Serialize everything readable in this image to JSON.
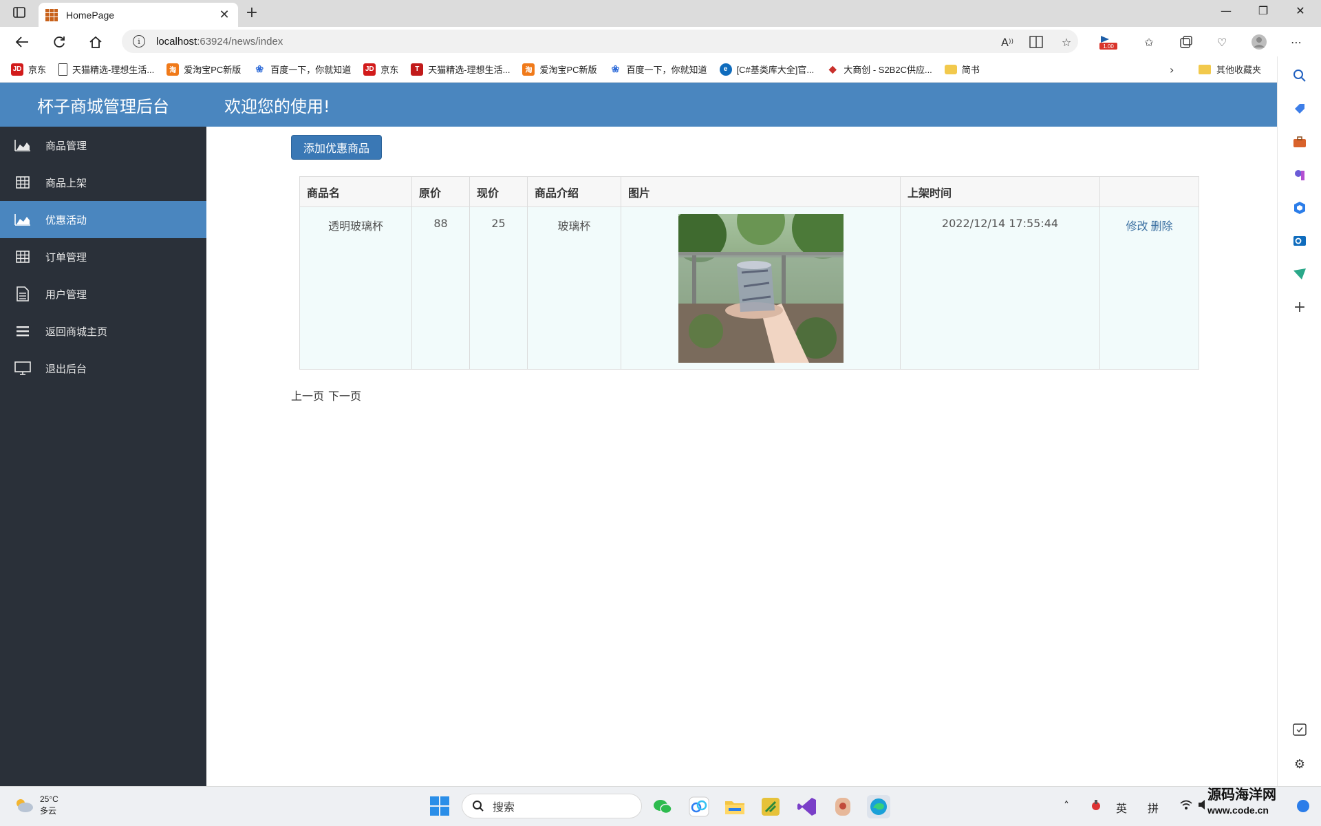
{
  "browser": {
    "tab_title": "HomePage",
    "url_host": "localhost",
    "url_path": ":63924/news/index",
    "bookmarks": [
      {
        "label": "京东",
        "icon": "jd-icon",
        "color": "#d21b1b",
        "glyph": "JD"
      },
      {
        "label": "天猫精选-理想生活...",
        "icon": "page-icon",
        "color": "#ffffff",
        "glyph": ""
      },
      {
        "label": "爱淘宝PC新版",
        "icon": "taobao-icon",
        "color": "#f07a1a",
        "glyph": "淘"
      },
      {
        "label": "百度一下，你就知道",
        "icon": "baidu-icon",
        "color": "#2f6cd9",
        "glyph": "❀"
      },
      {
        "label": "京东",
        "icon": "jd-icon",
        "color": "#d21b1b",
        "glyph": "JD"
      },
      {
        "label": "天猫精选-理想生活...",
        "icon": "tmall-icon",
        "color": "#c11a1a",
        "glyph": "T"
      },
      {
        "label": "爱淘宝PC新版",
        "icon": "taobao-icon",
        "color": "#f07a1a",
        "glyph": "淘"
      },
      {
        "label": "百度一下，你就知道",
        "icon": "baidu-icon",
        "color": "#2f6cd9",
        "glyph": "❀"
      },
      {
        "label": "[C#基类库大全]官...",
        "icon": "edge-icon",
        "color": "#0f6cbd",
        "glyph": "e"
      },
      {
        "label": "大商创 - S2B2C供应...",
        "icon": "dsc-icon",
        "color": "#c9302c",
        "glyph": "◆"
      },
      {
        "label": "简书",
        "icon": "folder-icon",
        "color": "#f2c94c",
        "glyph": ""
      }
    ],
    "other_bookmarks": "其他收藏夹",
    "zoom_badge": "1.00"
  },
  "app": {
    "brand": "杯子商城管理后台",
    "welcome": "欢迎您的使用!"
  },
  "sidebar": {
    "items": [
      {
        "label": "商品管理",
        "name": "sidebar-item-goods-manage",
        "icon": "area-chart-icon",
        "active": false
      },
      {
        "label": "商品上架",
        "name": "sidebar-item-goods-shelf",
        "icon": "table-icon",
        "active": false
      },
      {
        "label": "优惠活动",
        "name": "sidebar-item-promotions",
        "icon": "area-chart-icon",
        "active": true
      },
      {
        "label": "订单管理",
        "name": "sidebar-item-orders",
        "icon": "table-icon",
        "active": false
      },
      {
        "label": "用户管理",
        "name": "sidebar-item-users",
        "icon": "document-icon",
        "active": false
      },
      {
        "label": "返回商城主页",
        "name": "sidebar-item-back-home",
        "icon": "menu-icon",
        "active": false
      },
      {
        "label": "退出后台",
        "name": "sidebar-item-logout",
        "icon": "monitor-icon",
        "active": false
      }
    ]
  },
  "main": {
    "add_button": "添加优惠商品",
    "table": {
      "headers": [
        "商品名",
        "原价",
        "现价",
        "商品介绍",
        "图片",
        "上架时间",
        ""
      ],
      "rows": [
        {
          "name": "透明玻璃杯",
          "original_price": "88",
          "current_price": "25",
          "intro": "玻璃杯",
          "image": "glass-cup-photo",
          "listed_at": "2022/12/14 17:55:44",
          "edit": "修改",
          "delete": "删除"
        }
      ]
    },
    "pager": {
      "prev": "上一页",
      "next": "下一页"
    }
  },
  "taskbar": {
    "weather_temp": "25°C",
    "weather_desc": "多云",
    "search_placeholder": "搜索",
    "ime_lang": "英",
    "ime_mode": "拼",
    "watermark_line1": "源码海洋网",
    "watermark_line2": "www.code.cn"
  }
}
